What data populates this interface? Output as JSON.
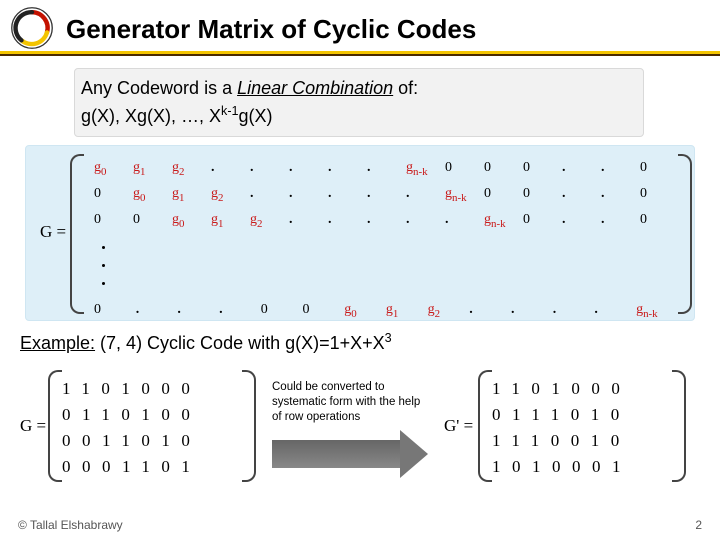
{
  "title": "Generator Matrix of Cyclic Codes",
  "intro": {
    "l1a": "Any Codeword is a ",
    "l1b": "Linear Combination",
    "l1c": " of:",
    "l2a": "g(X), Xg(X), …, X",
    "l2exp": "k-1",
    "l2b": "g(X)"
  },
  "G": {
    "label": "G =",
    "prime_label": "G' =",
    "cells": {
      "r1": [
        "g",
        "g",
        "g",
        ".",
        ".",
        ".",
        ".",
        ".",
        "g",
        "0",
        "0",
        "0",
        ".",
        ".",
        "0"
      ],
      "r1sub": [
        "0",
        "1",
        "2",
        "",
        "",
        "",
        "",
        "",
        "n-k",
        "",
        "",
        "",
        "",
        "",
        ""
      ],
      "r2": [
        "0",
        "g",
        "g",
        "g",
        ".",
        ".",
        ".",
        ".",
        ".",
        "g",
        "0",
        "0",
        ".",
        ".",
        "0"
      ],
      "r2sub": [
        "",
        "0",
        "1",
        "2",
        "",
        "",
        "",
        "",
        "",
        "n-k",
        "",
        "",
        "",
        "",
        ""
      ],
      "r3": [
        "0",
        "0",
        "g",
        "g",
        "g",
        ".",
        ".",
        ".",
        ".",
        ".",
        "g",
        "0",
        ".",
        ".",
        "0"
      ],
      "r3sub": [
        "",
        "",
        "0",
        "1",
        "2",
        "",
        "",
        "",
        "",
        "",
        "n-k",
        "",
        "",
        "",
        ""
      ],
      "rL": [
        "0",
        ".",
        ".",
        ".",
        "0",
        "0",
        "g",
        "g",
        "g",
        ".",
        ".",
        ".",
        ".",
        "g"
      ],
      "rLsub": [
        "",
        "",
        "",
        "",
        "",
        "",
        "0",
        "1",
        "2",
        "",
        "",
        "",
        "",
        "n-k"
      ]
    }
  },
  "example": {
    "label": "Example:",
    "text_a": " (7, 4) Cyclic Code with g(X)=1+X+X",
    "exp3": "3"
  },
  "mat1": [
    [
      1,
      1,
      0,
      1,
      0,
      0,
      0
    ],
    [
      0,
      1,
      1,
      0,
      1,
      0,
      0
    ],
    [
      0,
      0,
      1,
      1,
      0,
      1,
      0
    ],
    [
      0,
      0,
      0,
      1,
      1,
      0,
      1
    ]
  ],
  "mat2": [
    [
      1,
      1,
      0,
      1,
      0,
      0,
      0
    ],
    [
      0,
      1,
      1,
      1,
      0,
      1,
      0
    ],
    [
      1,
      1,
      1,
      0,
      0,
      1,
      0
    ],
    [
      1,
      0,
      1,
      0,
      0,
      0,
      1
    ]
  ],
  "convert": "Could be converted to systematic form with the help of row operations",
  "copyright": "© Tallal Elshabrawy",
  "page": "2"
}
